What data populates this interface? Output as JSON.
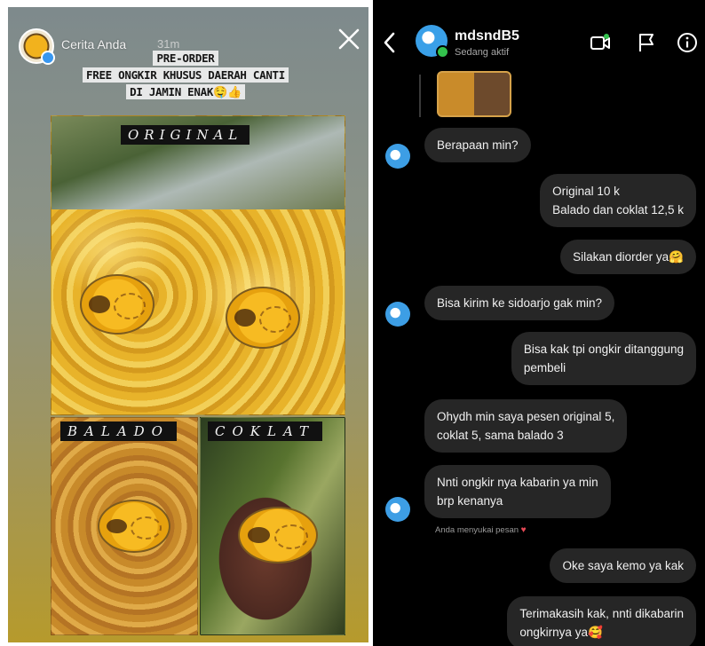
{
  "story": {
    "user": "Cerita Anda",
    "time": "31m",
    "caption_lines": [
      "PRE-ORDER",
      "FREE ONGKIR KHUSUS DAERAH CANTI",
      "DI JAMIN ENAK"
    ],
    "caption_emoji": "🤤👍",
    "labels": {
      "original": "ORIGINAL",
      "balado": "BALADO",
      "coklat": "COKLAT"
    }
  },
  "dm": {
    "username": "mdsndB5",
    "status": "Sedang aktif",
    "messages": [
      {
        "side": "in",
        "text": "Berapaan min?"
      },
      {
        "side": "out",
        "lines": [
          "Original 10 k",
          "Balado dan coklat 12,5 k"
        ]
      },
      {
        "side": "out",
        "text": "Silakan diorder ya🤗"
      },
      {
        "side": "in",
        "text": "Bisa kirim ke sidoarjo gak min?"
      },
      {
        "side": "out",
        "lines": [
          "Bisa kak tpi ongkir ditanggung",
          "pembeli"
        ]
      },
      {
        "side": "in",
        "lines": [
          "Ohydh min saya pesen original 5,",
          "coklat 5, sama balado 3"
        ]
      },
      {
        "side": "in",
        "lines": [
          "Nnti ongkir nya kabarin ya min",
          "brp kenanya"
        ]
      },
      {
        "side": "out",
        "text": "Oke saya kemo ya kak"
      },
      {
        "side": "out",
        "lines": [
          "Terimakasih kak, nnti dikabarin",
          "ongkirnya ya🥰"
        ]
      }
    ],
    "seen_note": "Anda menyukai pesan",
    "seen_heart": "♥"
  },
  "icons": [
    "close-icon",
    "back-chevron-icon",
    "video-call-icon",
    "flag-icon",
    "info-icon"
  ]
}
